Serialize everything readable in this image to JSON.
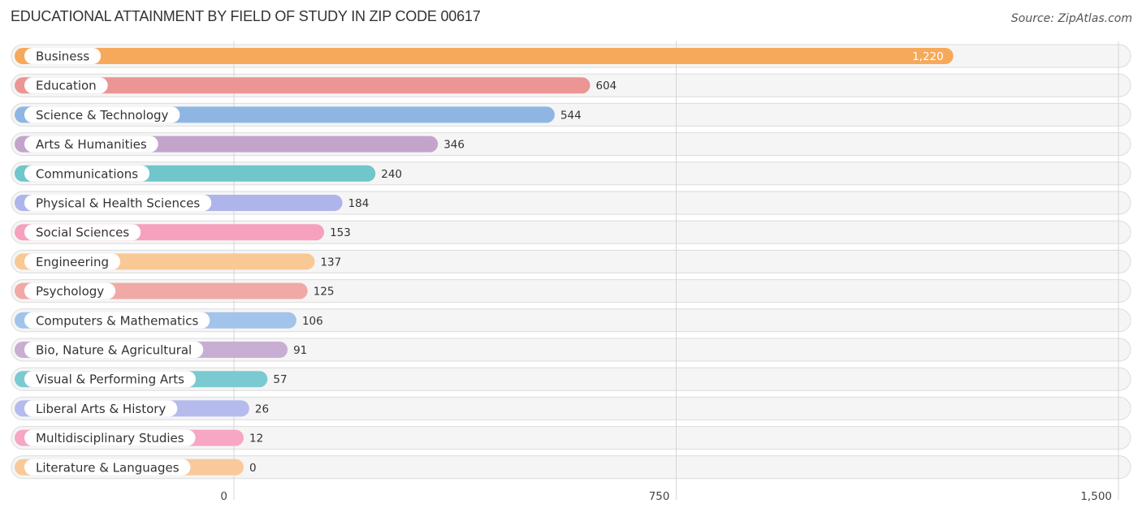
{
  "chart_data": {
    "type": "bar",
    "orientation": "horizontal",
    "title": "EDUCATIONAL ATTAINMENT BY FIELD OF STUDY IN ZIP CODE 00617",
    "source": "Source: ZipAtlas.com",
    "xlabel": "",
    "ylabel": "",
    "xlim": [
      0,
      1500
    ],
    "ticks": [
      0,
      750,
      1500
    ],
    "tick_labels": [
      "0",
      "750",
      "1,500"
    ],
    "grid": true,
    "categories": [
      "Business",
      "Education",
      "Science & Technology",
      "Arts & Humanities",
      "Communications",
      "Physical & Health Sciences",
      "Social Sciences",
      "Engineering",
      "Psychology",
      "Computers & Mathematics",
      "Bio, Nature & Agricultural",
      "Visual & Performing Arts",
      "Liberal Arts & History",
      "Multidisciplinary Studies",
      "Literature & Languages"
    ],
    "values": [
      1220,
      604,
      544,
      346,
      240,
      184,
      153,
      137,
      125,
      106,
      91,
      57,
      26,
      12,
      0
    ],
    "value_labels": [
      "1,220",
      "604",
      "544",
      "346",
      "240",
      "184",
      "153",
      "137",
      "125",
      "106",
      "91",
      "57",
      "26",
      "12",
      "0"
    ],
    "colors": [
      "#f6a95a",
      "#eb9594",
      "#8fb6e3",
      "#c3a5cb",
      "#6fc6cb",
      "#adb5ea",
      "#f6a1bd",
      "#f9c995",
      "#f1a9a6",
      "#a2c3ea",
      "#c8aed2",
      "#7ccad1",
      "#b5bbec",
      "#f7a6c3",
      "#f9c99b"
    ]
  }
}
